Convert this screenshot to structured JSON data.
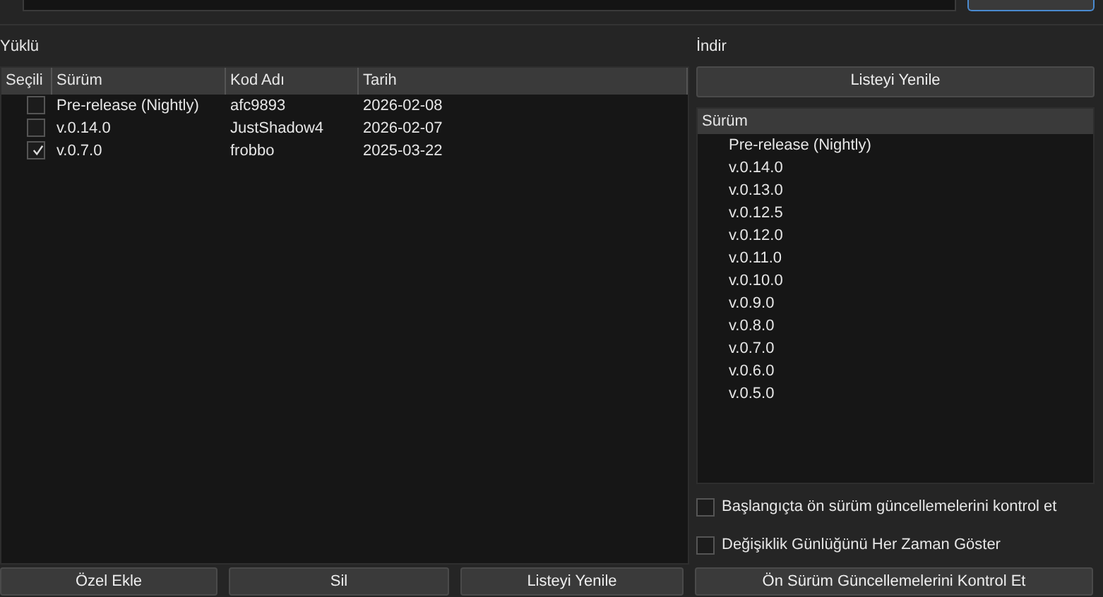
{
  "installed": {
    "label": "Yüklü",
    "columns": [
      "Seçili",
      "Sürüm",
      "Kod Adı",
      "Tarih"
    ],
    "rows": [
      {
        "checked": false,
        "version": "Pre-release (Nightly)",
        "codename": "afc9893",
        "date": "2026-02-08"
      },
      {
        "checked": false,
        "version": "v.0.14.0",
        "codename": "JustShadow4",
        "date": "2026-02-07"
      },
      {
        "checked": true,
        "version": "v.0.7.0",
        "codename": "frobbo",
        "date": "2025-03-22"
      }
    ]
  },
  "download": {
    "label": "İndir",
    "refresh_button": "Listeyi Yenile",
    "column": "Sürüm",
    "versions": [
      "Pre-release (Nightly)",
      "v.0.14.0",
      "v.0.13.0",
      "v.0.12.5",
      "v.0.12.0",
      "v.0.11.0",
      "v.0.10.0",
      "v.0.9.0",
      "v.0.8.0",
      "v.0.7.0",
      "v.0.6.0",
      "v.0.5.0"
    ],
    "options": [
      {
        "label": "Başlangıçta ön sürüm güncellemelerini kontrol et",
        "checked": false
      },
      {
        "label": "Değişiklik Günlüğünü Her Zaman Göster",
        "checked": false
      }
    ]
  },
  "buttons": [
    "Özel Ekle",
    "Sil",
    "Listeyi Yenile",
    "Ön Sürüm Güncellemelerini Kontrol Et"
  ]
}
